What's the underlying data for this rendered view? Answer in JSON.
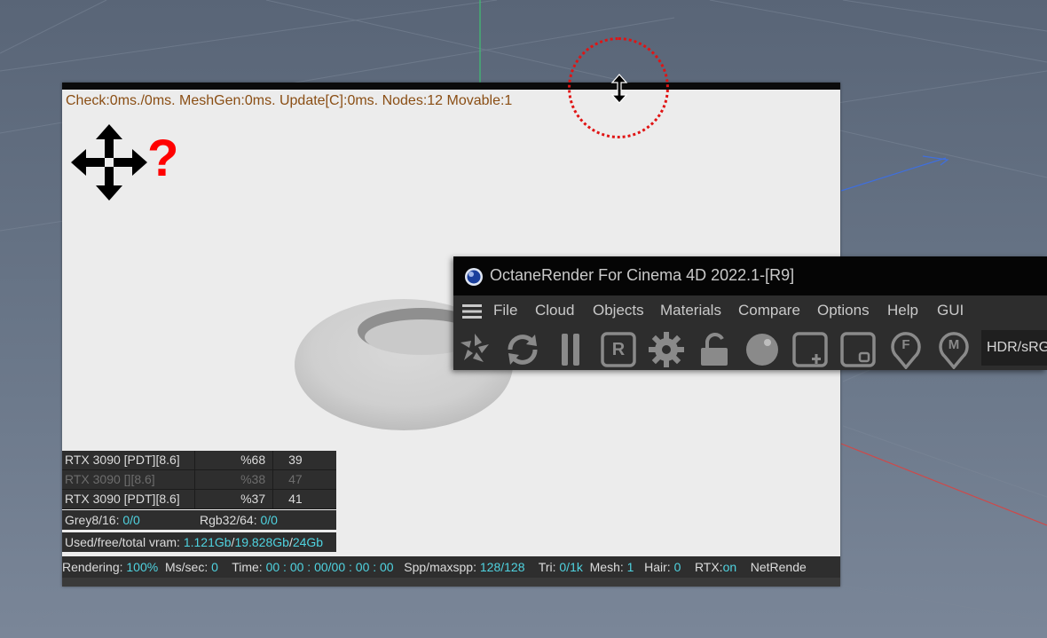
{
  "viewport": {
    "stats_line": "Check:0ms./0ms. MeshGen:0ms. Update[C]:0ms. Nodes:12 Movable:1",
    "question_mark": "?",
    "gpus": [
      {
        "name": "RTX 3090 [PDT][8.6]",
        "percent": "%68",
        "temp": "39"
      },
      {
        "name": "RTX 3090 [][8.6]",
        "percent": "%38",
        "temp": "47"
      },
      {
        "name": "RTX 3090 [PDT][8.6]",
        "percent": "%37",
        "temp": "41"
      }
    ],
    "textures": {
      "grey_label": "Grey8/16:",
      "grey_value": "0/0",
      "rgb_label": "Rgb32/64:",
      "rgb_value": "0/0"
    },
    "vram": {
      "label": "Used/free/total vram:",
      "used": "1.121Gb",
      "free": "19.828Gb",
      "total": "24Gb"
    },
    "status": {
      "rendering_label": "Rendering:",
      "rendering_value": "100%",
      "ms_label": "Ms/sec:",
      "ms_value": "0",
      "time_label": "Time:",
      "time_value": "00 : 00 : 00/00 : 00 : 00",
      "spp_label": "Spp/maxspp:",
      "spp_value": "128/128",
      "tri_label": "Tri:",
      "tri_value": "0/1k",
      "mesh_label": "Mesh:",
      "mesh_value": "1",
      "hair_label": "Hair:",
      "hair_value": "0",
      "rtx_label": "RTX:",
      "rtx_value": "on",
      "net_label": "NetRende"
    }
  },
  "octane_window": {
    "title": "OctaneRender For Cinema 4D 2022.1-[R9]",
    "menu": [
      "File",
      "Cloud",
      "Objects",
      "Materials",
      "Compare",
      "Options",
      "Help",
      "GUI"
    ],
    "toolbar_icons": [
      "send-scene-icon",
      "restart-render-icon",
      "pause-icon",
      "region-render-icon",
      "settings-gear-icon",
      "lock-icon",
      "material-ball-icon",
      "add-region-icon",
      "focus-region-icon",
      "focus-picker-icon",
      "material-picker-icon"
    ],
    "region_letter": "R",
    "focus_letter": "F",
    "material_letter": "M",
    "color_space": "HDR/sRG"
  },
  "colors": {
    "cyan_value": "#4fd3e0",
    "stats_text": "#8a4e14",
    "highlight_red": "#e01414"
  }
}
